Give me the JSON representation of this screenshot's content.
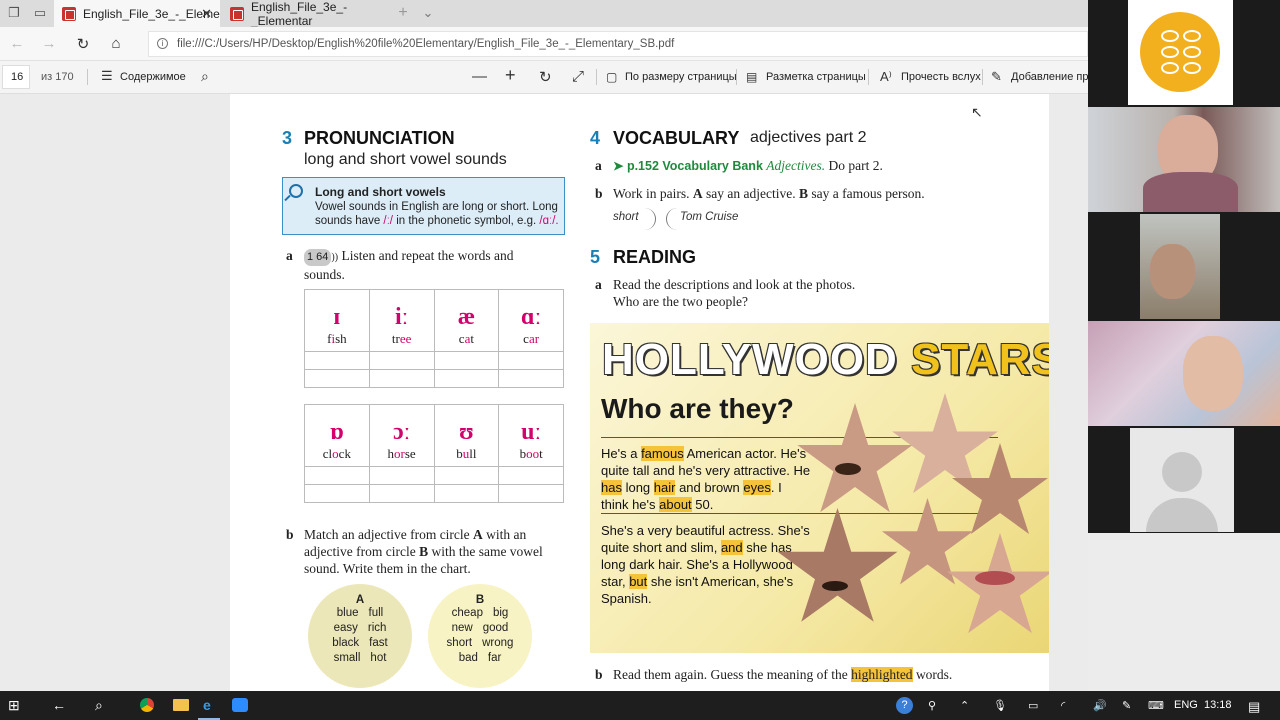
{
  "browser": {
    "tabs": [
      {
        "title": "English_File_3e_-_Eleme",
        "active": true
      },
      {
        "title": "English_File_3e_-_Elementar",
        "active": false
      }
    ],
    "url": "file:///C:/Users/HP/Desktop/English%20file%20Elementary/English_File_3e_-_Elementary_SB.pdf"
  },
  "pdf_toolbar": {
    "page_number": "16",
    "page_total": "из 170",
    "contents_label": "Содержимое",
    "fit_page_label": "По размеру страницы",
    "page_layout_label": "Разметка страницы",
    "read_aloud_label": "Прочесть вслух",
    "add_notes_label": "Добавление при"
  },
  "page": {
    "s3": {
      "num": "3",
      "title": "PRONUNCIATION",
      "subtitle": "long and short vowel sounds",
      "tip_title": "Long and short vowels",
      "tip_text_a": "Vowel sounds in English are long or short. Long sounds have",
      "tip_symbol": "/ː/",
      "tip_text_b": "in the phonetic symbol, e.g.",
      "tip_example": "/ɑː/.",
      "a_label": "a",
      "a_track": "1 64",
      "a_text": "Listen and repeat the words and sounds.",
      "row1": [
        {
          "glyph": "ɪ",
          "word_a": "f",
          "word_hl": "i",
          "word_b": "sh"
        },
        {
          "glyph": "iː",
          "word_a": "tr",
          "word_hl": "ee",
          "word_b": ""
        },
        {
          "glyph": "æ",
          "word_a": "c",
          "word_hl": "a",
          "word_b": "t"
        },
        {
          "glyph": "ɑː",
          "word_a": "c",
          "word_hl": "ar",
          "word_b": ""
        }
      ],
      "row2": [
        {
          "glyph": "ɒ",
          "word_a": "cl",
          "word_hl": "o",
          "word_b": "ck"
        },
        {
          "glyph": "ɔː",
          "word_a": "h",
          "word_hl": "or",
          "word_b": "se"
        },
        {
          "glyph": "ʊ",
          "word_a": "b",
          "word_hl": "u",
          "word_b": "ll"
        },
        {
          "glyph": "uː",
          "word_a": "b",
          "word_hl": "oo",
          "word_b": "t"
        }
      ],
      "b_label": "b",
      "b_text_a": "Match an adjective from circle ",
      "b_text_A": "A",
      "b_text_b": " with an adjective from circle ",
      "b_text_B": "B",
      "b_text_c": " with the same vowel sound. Write them in the chart.",
      "circle_a": {
        "heading": "A",
        "rows": [
          [
            "blue",
            "full"
          ],
          [
            "easy",
            "rich"
          ],
          [
            "black",
            "fast"
          ],
          [
            "small",
            "hot"
          ]
        ]
      },
      "circle_b": {
        "heading": "B",
        "rows": [
          [
            "cheap",
            "big"
          ],
          [
            "new",
            "good"
          ],
          [
            "short",
            "wrong"
          ],
          [
            "bad",
            "far"
          ]
        ]
      }
    },
    "s4": {
      "num": "4",
      "title": "VOCABULARY",
      "subtitle": "adjectives part 2",
      "a_label": "a",
      "a_link": "p.152 Vocabulary Bank",
      "a_italic": "Adjectives.",
      "a_rest": "Do part 2.",
      "b_label": "b",
      "b_text_a": "Work in pairs. ",
      "b_text_A": "A",
      "b_text_b": " say an adjective. ",
      "b_text_B": "B",
      "b_text_c": " say a famous person.",
      "bubble_1": "short",
      "bubble_2": "Tom Cruise"
    },
    "s5": {
      "num": "5",
      "title": "READING",
      "a_label": "a",
      "a_line1": "Read the descriptions and look at the photos.",
      "a_line2": "Who are the two people?",
      "mag_title_a": "HOLLYWOOD",
      "mag_title_b": "STARS",
      "mag_subtitle": "Who are they?",
      "p1": [
        {
          "t": "He's a ",
          "hl": false
        },
        {
          "t": "famous",
          "hl": true
        },
        {
          "t": " American actor. He's quite tall and he's very attractive. He ",
          "hl": false
        },
        {
          "t": "has",
          "hl": true
        },
        {
          "t": " long ",
          "hl": false
        },
        {
          "t": "hair",
          "hl": true
        },
        {
          "t": " and brown ",
          "hl": false
        },
        {
          "t": "eyes",
          "hl": true
        },
        {
          "t": ". I think he's ",
          "hl": false
        },
        {
          "t": "about",
          "hl": true
        },
        {
          "t": " 50.",
          "hl": false
        }
      ],
      "p2": [
        {
          "t": "She's a very beautiful actress. She's quite short and slim, ",
          "hl": false
        },
        {
          "t": "and",
          "hl": true
        },
        {
          "t": " she has long dark hair. She's a Hollywood star, ",
          "hl": false
        },
        {
          "t": "but",
          "hl": true
        },
        {
          "t": " she isn't American, she's Spanish.",
          "hl": false
        }
      ],
      "b_label": "b",
      "b_text_a": "Read them again. Guess the meaning of the ",
      "b_text_hl": "highlighted",
      "b_text_b": " words."
    }
  },
  "taskbar": {
    "language": "ENG",
    "time": "13:18"
  },
  "colors": {
    "section_blue": "#1a7fb5",
    "phoneme_pink": "#d4006b",
    "vocab_green": "#1f8a3c",
    "highlight": "#f4c33a",
    "app_logo": "#f2b01e"
  }
}
